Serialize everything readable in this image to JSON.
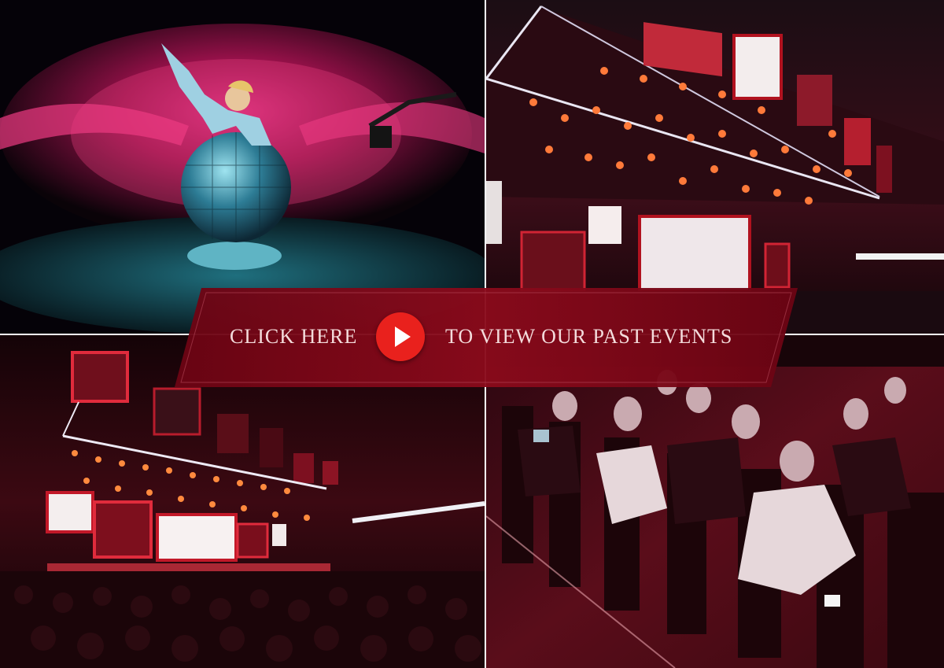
{
  "cta": {
    "left_text": "CLICK HERE",
    "right_text": "TO VIEW OUR PAST EVENTS",
    "play_icon": "play-icon",
    "band_color": "#7e0716",
    "button_color": "#e9211d"
  },
  "photos": [
    {
      "position": "top-left",
      "subject": "acrobat-on-mirror-ball"
    },
    {
      "position": "top-right",
      "subject": "arena-stage-lighting-rig"
    },
    {
      "position": "bottom-left",
      "subject": "conference-stage-with-screens"
    },
    {
      "position": "bottom-right",
      "subject": "seated-audience"
    }
  ]
}
